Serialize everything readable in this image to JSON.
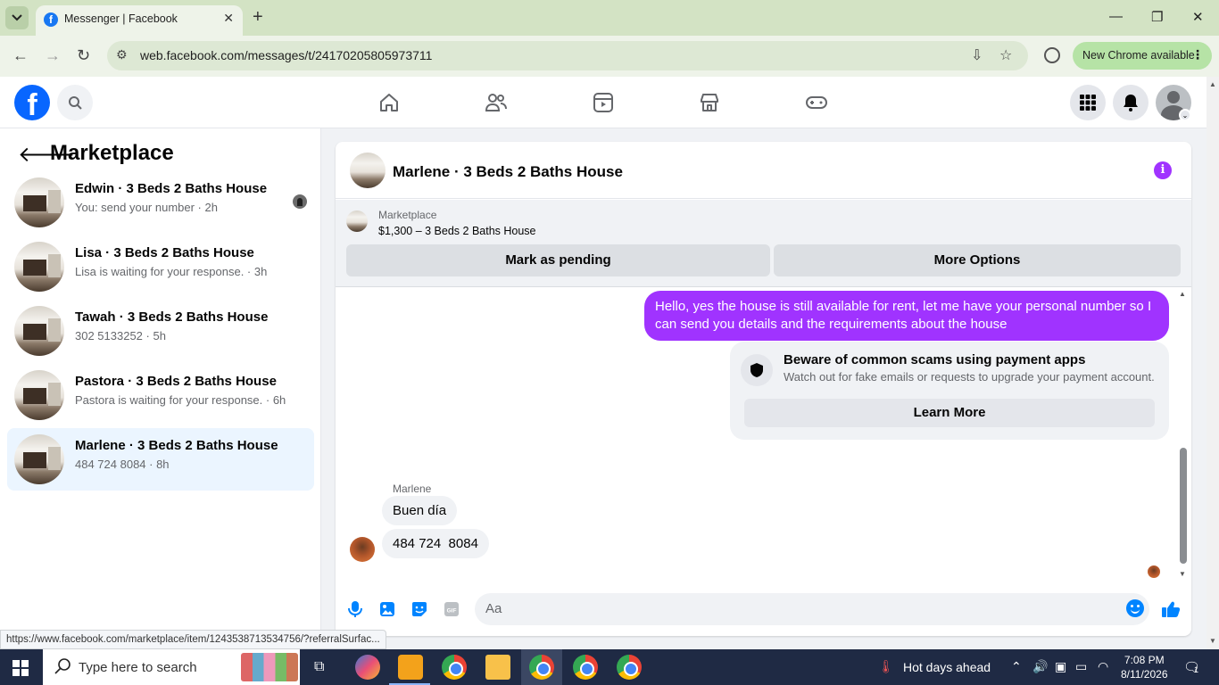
{
  "browser": {
    "tab_title": "Messenger | Facebook",
    "url": "web.facebook.com/messages/t/24170205805973711",
    "new_chrome_label": "New Chrome available",
    "status_url": "https://www.facebook.com/marketplace/item/1243538713534756/?referralSurfac..."
  },
  "sidebar": {
    "title": "Marketplace",
    "conversations": [
      {
        "name": "Edwin · 3 Beds 2 Baths House",
        "snippet": "You: send your number · 2h"
      },
      {
        "name": "Lisa · 3 Beds 2 Baths House",
        "snippet": "Lisa is waiting for your response. · 3h"
      },
      {
        "name": "Tawah · 3 Beds 2 Baths House",
        "snippet": "302 5133252 · 5h"
      },
      {
        "name": "Pastora · 3 Beds 2 Baths House",
        "snippet": "Pastora is waiting for your response. · 6h"
      },
      {
        "name": "Marlene · 3 Beds 2 Baths House",
        "snippet": "484 724 8084 · 8h"
      }
    ]
  },
  "chat": {
    "title": "Marlene · 3 Beds 2 Baths House",
    "marketplace_label": "Marketplace",
    "listing": "$1,300 – 3 Beds 2 Baths House",
    "mark_pending": "Mark as pending",
    "more_options": "More Options",
    "outgoing_message": "Hello, yes the house is still available for rent, let me have your personal number so I can send you details and the requirements about the house",
    "scam_title": "Beware of common scams using payment apps",
    "scam_text": "Watch out for fake emails or requests to upgrade your payment account.",
    "learn_more": "Learn More",
    "sender_name": "Marlene",
    "incoming": [
      "Buen día",
      "484 724  8084"
    ],
    "composer_placeholder": "Aa"
  },
  "taskbar": {
    "search_placeholder": "Type here to search",
    "weather": "Hot days ahead",
    "time": "7:08 PM",
    "date": "8/11/2026",
    "notification_count": "1"
  }
}
